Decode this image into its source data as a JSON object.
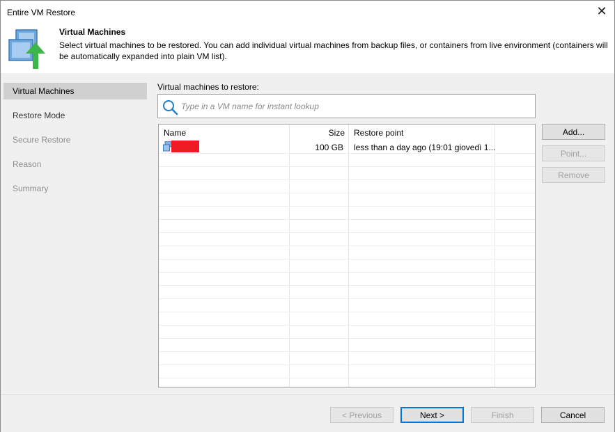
{
  "window": {
    "title": "Entire VM Restore",
    "close_glyph": "✕"
  },
  "header": {
    "title": "Virtual Machines",
    "description": "Select virtual machines to be restored. You can add individual virtual machines from backup files, or containers from live environment (containers will be automatically expanded into plain VM list).",
    "icon": "vm-restore-icon"
  },
  "steps": [
    {
      "label": "Virtual Machines",
      "state": "active"
    },
    {
      "label": "Restore Mode",
      "state": "enabled"
    },
    {
      "label": "Secure Restore",
      "state": "disabled"
    },
    {
      "label": "Reason",
      "state": "disabled"
    },
    {
      "label": "Summary",
      "state": "disabled"
    }
  ],
  "main": {
    "section_label": "Virtual machines to restore:",
    "search": {
      "value": "",
      "placeholder": "Type in a VM name for instant lookup",
      "icon": "search-icon"
    }
  },
  "table": {
    "columns": {
      "name": "Name",
      "size": "Size",
      "restore_point": "Restore point"
    },
    "rows": [
      {
        "name": "",
        "name_redacted": true,
        "size": "100 GB",
        "restore_point": "less than a day ago (19:01 giovedì 1...",
        "icon": "vm-icon"
      }
    ]
  },
  "side_buttons": {
    "add": "Add...",
    "point": "Point...",
    "remove": "Remove"
  },
  "footer": {
    "previous": "< Previous",
    "next": "Next >",
    "finish": "Finish",
    "cancel": "Cancel"
  },
  "colors": {
    "accent": "#0078d7",
    "active_step_bg": "#d0d0d0",
    "redaction": "#ee1c25",
    "panel_bg": "#f0f0f0"
  }
}
